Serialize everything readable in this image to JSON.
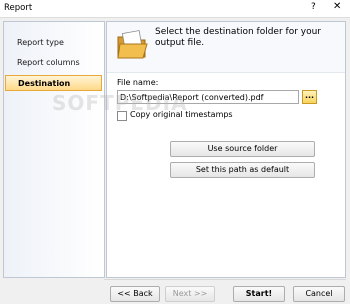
{
  "window": {
    "title": "Report",
    "help": "?",
    "close": "✕"
  },
  "sidebar": {
    "items": [
      {
        "label": "Report type"
      },
      {
        "label": "Report columns"
      },
      {
        "label": "Destination"
      }
    ]
  },
  "main": {
    "header": "Select the destination folder for your output file.",
    "file_label": "File name:",
    "file_value": "D:\\Softpedia\\Report (converted).pdf",
    "browse_label": "...",
    "checkbox_label": "Copy original timestamps",
    "use_source_label": "Use source folder",
    "set_default_label": "Set this path as default"
  },
  "footer": {
    "back_label": "<< Back",
    "next_label": "Next >>",
    "start_label": "Start!",
    "cancel_label": "Cancel"
  },
  "watermark": "SOFTPEDIA"
}
